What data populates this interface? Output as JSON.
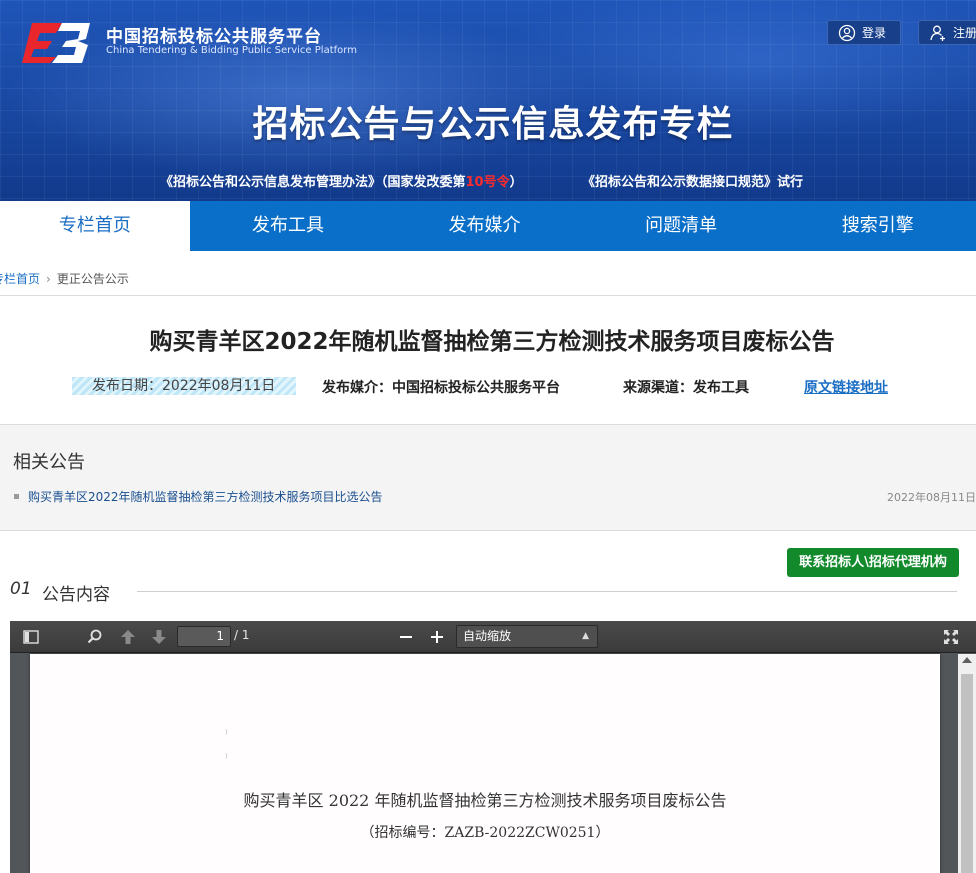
{
  "header": {
    "logo_cn": "中国招标投标公共服务平台",
    "logo_en": "China Tendering & Bidding Public Service Platform",
    "login_label": "登录",
    "register_label": "注册",
    "banner_title": "招标公告与公示信息发布专栏",
    "sub_link_1_a": "《招标公告和公示信息发布管理办法》（国家发改委第",
    "sub_link_1_red": "10号令",
    "sub_link_1_b": "）",
    "sub_link_2": "《招标公告和公示数据接口规范》试行"
  },
  "nav": {
    "items": [
      "专栏首页",
      "发布工具",
      "发布媒介",
      "问题清单",
      "搜索引擎"
    ]
  },
  "breadcrumb": {
    "home": "专栏首页",
    "current": "更正公告公示"
  },
  "article": {
    "title": "购买青羊区2022年随机监督抽检第三方检测技术服务项目废标公告",
    "date": "发布日期：2022年08月11日",
    "media": "发布媒介：中国招标投标公共服务平台",
    "channel": "来源渠道：发布工具",
    "source_link": "原文链接地址"
  },
  "related": {
    "title": "相关公告",
    "items": [
      {
        "title": "购买青羊区2022年随机监督抽检第三方检测技术服务项目比选公告",
        "date": "2022年08月11日"
      }
    ]
  },
  "section": {
    "contact_button": "联系招标人\\招标代理机构",
    "number": "01",
    "name": "公告内容"
  },
  "pdf_viewer": {
    "page_value": "1",
    "page_total": "/ 1",
    "zoom_label": "自动缩放",
    "doc_title": "购买青羊区 2022 年随机监督抽检第三方检测技术服务项目废标公告",
    "doc_number": "（招标编号：ZAZB-2022ZCW0251）"
  },
  "colors": {
    "nav_blue": "#0a6fc8",
    "active_text": "#1a6ec4",
    "contact_green": "#128a2c",
    "highlight_red": "#ff2b2b"
  },
  "icons": [
    "logo-icon",
    "user-circle-icon",
    "user-add-icon",
    "sidebar-toggle-icon",
    "search-icon",
    "arrow-up-icon",
    "arrow-down-icon",
    "zoom-out-icon",
    "zoom-in-icon",
    "fullscreen-icon"
  ]
}
